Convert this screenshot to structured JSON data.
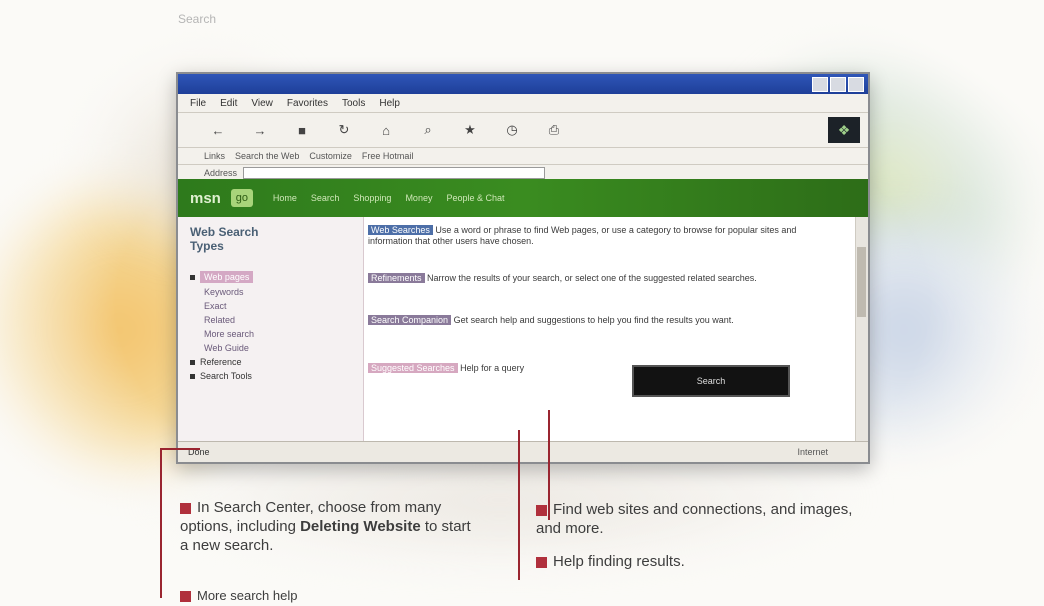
{
  "caption": "Search",
  "window": {
    "menu": [
      "File",
      "Edit",
      "View",
      "Favorites",
      "Tools",
      "Help"
    ],
    "toolbar_icons": [
      "back-icon",
      "forward-icon",
      "stop-icon",
      "refresh-icon",
      "home-icon",
      "search-icon",
      "favorites-icon",
      "history-icon",
      "print-icon"
    ],
    "links": [
      "Address",
      "Links",
      "Search the Web",
      "Customize",
      "Free Hotmail"
    ],
    "address_label": "Address"
  },
  "page": {
    "banner_logo": "msn",
    "banner_badge": "go",
    "banner_tabs": [
      "Home",
      "Search",
      "Shopping",
      "Money",
      "People & Chat"
    ],
    "sidebar_title": "Web Search Types",
    "sidebar_items": [
      {
        "label": "Web pages",
        "selected": true
      },
      {
        "label": "Keywords",
        "sub": true
      },
      {
        "label": "Exact",
        "sub": true
      },
      {
        "label": "Related",
        "sub": true
      },
      {
        "label": "More search",
        "sub": true
      },
      {
        "label": "Web Guide",
        "sub": true
      },
      {
        "label": "Reference",
        "sub": false
      },
      {
        "label": "Search Tools",
        "sub": false
      }
    ],
    "content": {
      "p1_highlight": "Web Searches",
      "p1_text": "Use a word or phrase to find Web pages, or use a category to browse for popular sites and information that other users have chosen.",
      "p2_highlight": "Refinements",
      "p2_text": "Narrow the results of your search, or select one of the suggested related searches.",
      "p3_highlight": "Search Companion",
      "p3_text": "Get search help and suggestions to help you find the results you want.",
      "p4_highlight": "Suggested Searches",
      "p4_text": "Help for a query",
      "dark_box": "Search"
    },
    "status": [
      "Done",
      "Internet"
    ]
  },
  "callouts": {
    "left": {
      "lead": "In Search Center,",
      "text": "choose from many options, including",
      "bold": "Deleting Website",
      "tail": "to start a new search.",
      "extra": "More search help"
    },
    "right": {
      "line1": "Find web sites and connections,",
      "line2": "and images, and more.",
      "line3": "Help finding results."
    }
  }
}
